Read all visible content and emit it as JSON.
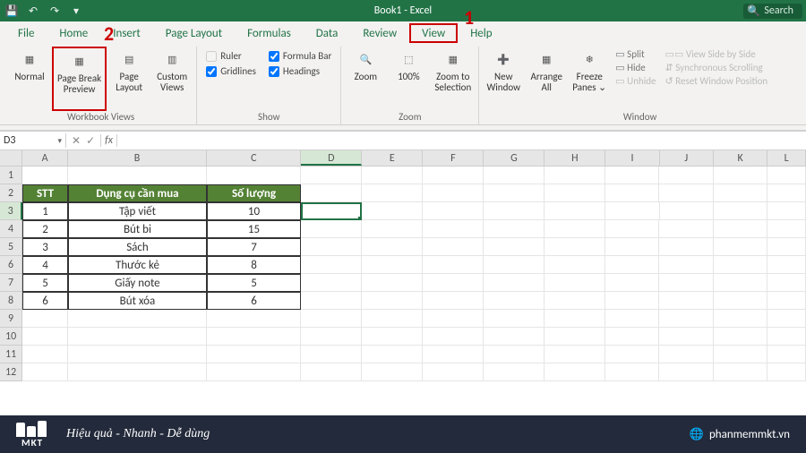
{
  "title": "Book1 - Excel",
  "search_placeholder": "Search",
  "annotations": {
    "a1": "1",
    "a2": "2"
  },
  "tabs": [
    "File",
    "Home",
    "Insert",
    "Page Layout",
    "Formulas",
    "Data",
    "Review",
    "View",
    "Help"
  ],
  "active_tab": "View",
  "ribbon": {
    "views": {
      "normal": "Normal",
      "page_break": "Page Break\nPreview",
      "page_layout": "Page\nLayout",
      "custom": "Custom\nViews",
      "group_label": "Workbook Views"
    },
    "show": {
      "ruler": "Ruler",
      "gridlines": "Gridlines",
      "formula_bar": "Formula Bar",
      "headings": "Headings",
      "group_label": "Show"
    },
    "zoom": {
      "zoom": "Zoom",
      "hundred": "100%",
      "to_selection": "Zoom to\nSelection",
      "group_label": "Zoom"
    },
    "window": {
      "new_window": "New\nWindow",
      "arrange_all": "Arrange\nAll",
      "freeze": "Freeze\nPanes ⌄",
      "split": "Split",
      "hide": "Hide",
      "unhide": "Unhide",
      "view_side": "View Side by Side",
      "sync": "Synchronous Scrolling",
      "reset": "Reset Window Position",
      "group_label": "Window"
    }
  },
  "namebox": "D3",
  "columns": [
    "A",
    "B",
    "C",
    "D",
    "E",
    "F",
    "G",
    "H",
    "I",
    "J",
    "K",
    "L"
  ],
  "selected_col": "D",
  "selected_row": 3,
  "row_labels": [
    1,
    2,
    3,
    4,
    5,
    6,
    7,
    8,
    9,
    10,
    11,
    12
  ],
  "table": {
    "headers": [
      "STT",
      "Dụng cụ cần mua",
      "Số lượng"
    ],
    "rows": [
      [
        "1",
        "Tập viết",
        "10"
      ],
      [
        "2",
        "Bút bi",
        "15"
      ],
      [
        "3",
        "Sách",
        "7"
      ],
      [
        "4",
        "Thước kẻ",
        "8"
      ],
      [
        "5",
        "Giấy note",
        "5"
      ],
      [
        "6",
        "Bút xóa",
        "6"
      ]
    ]
  },
  "footer": {
    "brand": "MKT",
    "tagline": "Hiệu quả - Nhanh - Dễ dùng",
    "site": "phanmemmkt.vn"
  }
}
